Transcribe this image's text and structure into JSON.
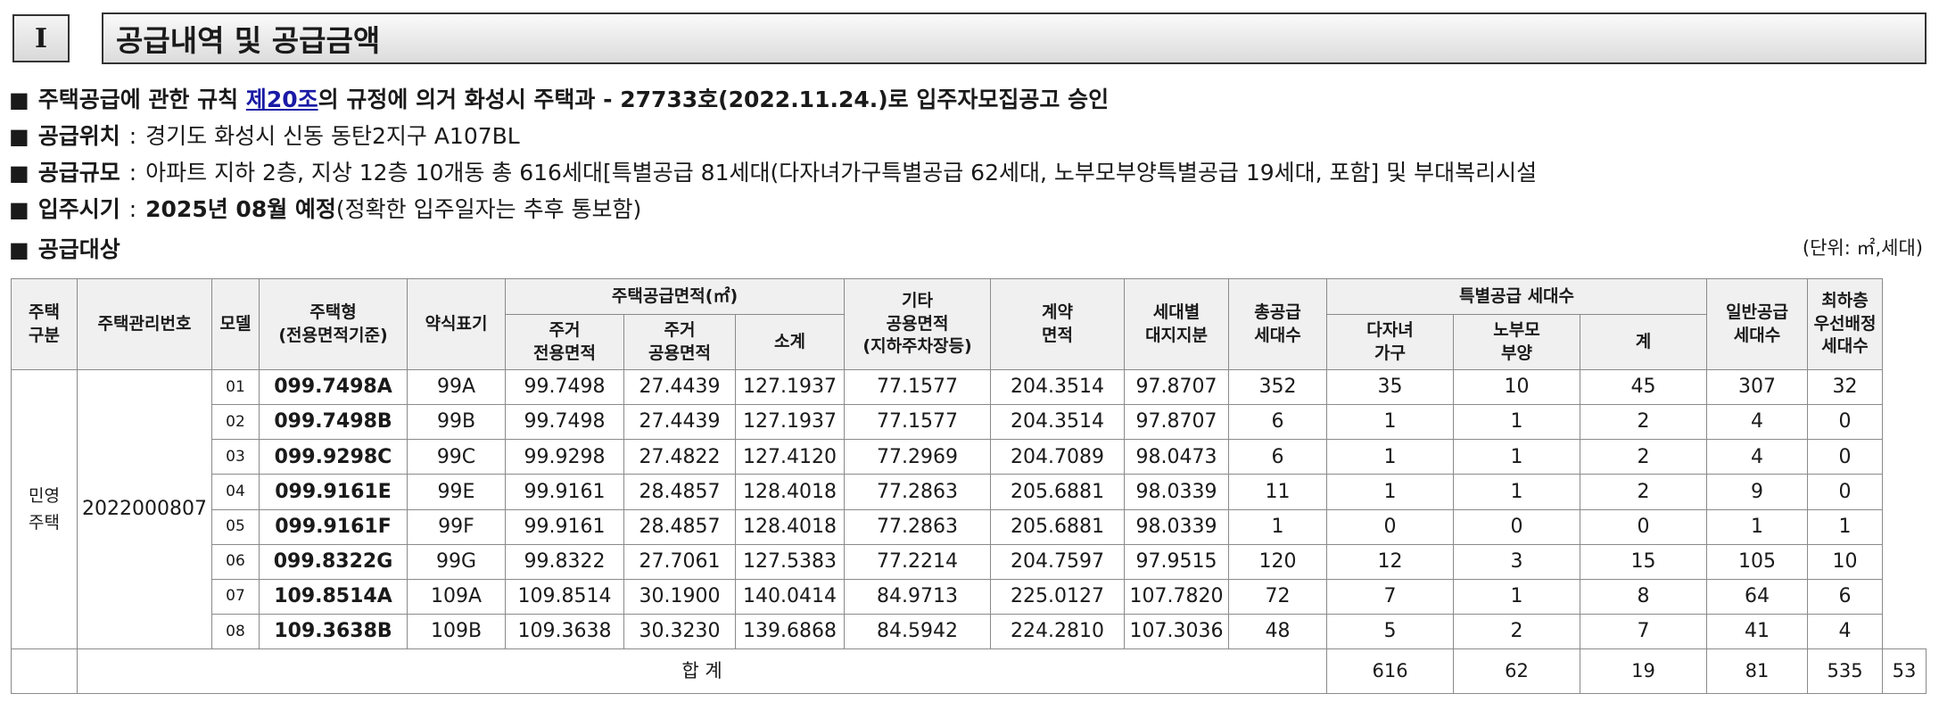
{
  "section": {
    "number": "I",
    "title": "공급내역 및 공급금액"
  },
  "bullets": {
    "b1": {
      "pre": "주택공급에 관한 규칙 ",
      "link": "제20조",
      "post": "의 규정에 의거 화성시 주택과 - 27733호(2022.11.24.)로 입주자모집공고 승인"
    },
    "b2": {
      "label": "공급위치",
      "colon": ":",
      "text": "경기도 화성시 신동 동탄2지구 A107BL"
    },
    "b3": {
      "label": "공급규모",
      "colon": ":",
      "text": "아파트 지하 2층, 지상 12층 10개동 총 616세대[특별공급 81세대(다자녀가구특별공급 62세대, 노부모부양특별공급 19세대, 포함] 및 부대복리시설"
    },
    "b4": {
      "label": "입주시기",
      "colon": ":",
      "bold": "2025년 08월 예정",
      "text": "(정확한 입주일자는 추후 통보함)"
    },
    "b5": {
      "label": "공급대상"
    }
  },
  "unit": "(단위: ㎡,세대)",
  "table": {
    "headers": {
      "category": [
        "주택",
        "구분"
      ],
      "mgmt_no": "주택관리번호",
      "model": "모델",
      "house_type": [
        "주택형",
        "(전용면적기준)"
      ],
      "abbr": "약식표기",
      "supply_area": "주택공급면적(㎡)",
      "exclusive": [
        "주거",
        "전용면적"
      ],
      "common": [
        "주거",
        "공용면적"
      ],
      "subtotal": "소계",
      "other": [
        "기타",
        "공용면적",
        "(지하주차장등)"
      ],
      "contract": [
        "계약",
        "면적"
      ],
      "land": [
        "세대별",
        "대지지분"
      ],
      "total_supply": [
        "총공급",
        "세대수"
      ],
      "special": "특별공급 세대수",
      "multi_child": [
        "다자녀",
        "가구"
      ],
      "parents": [
        "노부모",
        "부양"
      ],
      "special_sum": "계",
      "general": [
        "일반공급",
        "세대수"
      ],
      "lowest_floor": [
        "최하층",
        "우선배정",
        "세대수"
      ]
    },
    "category": [
      "민영",
      "주택"
    ],
    "mgmt_no": "2022000807",
    "rows": [
      {
        "model": "01",
        "type": "099.7498A",
        "abbr": "99A",
        "excl": "99.7498",
        "comm": "27.4439",
        "sub": "127.1937",
        "other": "77.1577",
        "contract": "204.3514",
        "land": "97.8707",
        "total": "352",
        "multi": "35",
        "parents": "10",
        "ssum": "45",
        "general": "307",
        "lowest": "32"
      },
      {
        "model": "02",
        "type": "099.7498B",
        "abbr": "99B",
        "excl": "99.7498",
        "comm": "27.4439",
        "sub": "127.1937",
        "other": "77.1577",
        "contract": "204.3514",
        "land": "97.8707",
        "total": "6",
        "multi": "1",
        "parents": "1",
        "ssum": "2",
        "general": "4",
        "lowest": "0"
      },
      {
        "model": "03",
        "type": "099.9298C",
        "abbr": "99C",
        "excl": "99.9298",
        "comm": "27.4822",
        "sub": "127.4120",
        "other": "77.2969",
        "contract": "204.7089",
        "land": "98.0473",
        "total": "6",
        "multi": "1",
        "parents": "1",
        "ssum": "2",
        "general": "4",
        "lowest": "0"
      },
      {
        "model": "04",
        "type": "099.9161E",
        "abbr": "99E",
        "excl": "99.9161",
        "comm": "28.4857",
        "sub": "128.4018",
        "other": "77.2863",
        "contract": "205.6881",
        "land": "98.0339",
        "total": "11",
        "multi": "1",
        "parents": "1",
        "ssum": "2",
        "general": "9",
        "lowest": "0"
      },
      {
        "model": "05",
        "type": "099.9161F",
        "abbr": "99F",
        "excl": "99.9161",
        "comm": "28.4857",
        "sub": "128.4018",
        "other": "77.2863",
        "contract": "205.6881",
        "land": "98.0339",
        "total": "1",
        "multi": "0",
        "parents": "0",
        "ssum": "0",
        "general": "1",
        "lowest": "1"
      },
      {
        "model": "06",
        "type": "099.8322G",
        "abbr": "99G",
        "excl": "99.8322",
        "comm": "27.7061",
        "sub": "127.5383",
        "other": "77.2214",
        "contract": "204.7597",
        "land": "97.9515",
        "total": "120",
        "multi": "12",
        "parents": "3",
        "ssum": "15",
        "general": "105",
        "lowest": "10"
      },
      {
        "model": "07",
        "type": "109.8514A",
        "abbr": "109A",
        "excl": "109.8514",
        "comm": "30.1900",
        "sub": "140.0414",
        "other": "84.9713",
        "contract": "225.0127",
        "land": "107.7820",
        "total": "72",
        "multi": "7",
        "parents": "1",
        "ssum": "8",
        "general": "64",
        "lowest": "6"
      },
      {
        "model": "08",
        "type": "109.3638B",
        "abbr": "109B",
        "excl": "109.3638",
        "comm": "30.3230",
        "sub": "139.6868",
        "other": "84.5942",
        "contract": "224.2810",
        "land": "107.3036",
        "total": "48",
        "multi": "5",
        "parents": "2",
        "ssum": "7",
        "general": "41",
        "lowest": "4"
      }
    ],
    "total_row": {
      "label": "합 계",
      "total": "616",
      "multi": "62",
      "parents": "19",
      "ssum": "81",
      "general": "535",
      "lowest": "53"
    }
  }
}
